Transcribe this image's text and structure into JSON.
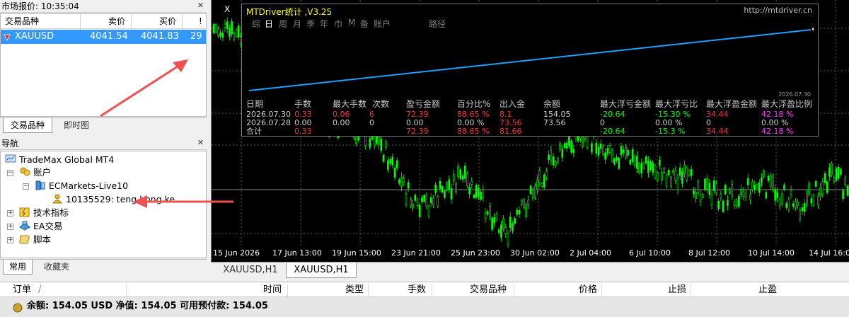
{
  "market_watch": {
    "title": "市场报价: 10:35:04",
    "columns": {
      "symbol": "交易品种",
      "bid": "卖价",
      "ask": "买价",
      "spread": "!"
    },
    "rows": [
      {
        "symbol": "XAUUSD",
        "bid": "4041.54",
        "ask": "4041.83",
        "spread": "29",
        "direction": "down"
      }
    ],
    "tabs": [
      {
        "label": "交易品种",
        "active": true
      },
      {
        "label": "即时图",
        "active": false
      }
    ]
  },
  "navigator": {
    "title": "导航",
    "root": "TradeMax Global MT4",
    "accounts_label": "账户",
    "server": "ECMarkets-Live10",
    "account": "10135529: teng hong ke",
    "indicators": "技术指标",
    "experts": "EA交易",
    "scripts": "脚本",
    "tabs": [
      {
        "label": "常用",
        "active": true
      },
      {
        "label": "收藏夹",
        "active": false
      }
    ]
  },
  "chart": {
    "symbol_label": "X",
    "background": "#000000",
    "candle_color": "#00ff00",
    "grid_color": "#5a5a5a",
    "x_ticks": [
      "15 Jun 2026",
      "17 Jun 13:00",
      "19 Jun 15:00",
      "23 Jun 21:00",
      "25 Jun 23:00",
      "30 Jun 02:00",
      "2 Jul 04:00",
      "6 Jul 10:00",
      "8 Jul 12:00",
      "10 Jul 14:00",
      "14 Jul 16:00"
    ],
    "tabs": [
      {
        "label": "XAUUSD,H1",
        "active": false
      },
      {
        "label": "XAUUSD,H1",
        "active": true
      }
    ]
  },
  "mtdriver": {
    "title": "MTDriver统计 ,V3.25",
    "url": "http://mtdriver.cn",
    "tabs": [
      "综",
      "日",
      "周",
      "月",
      "季",
      "年",
      "巾",
      "M",
      "备",
      "账户",
      "路径"
    ],
    "selected_tab": "日",
    "equity_date_label": "2026.07.30",
    "headers": [
      "日期",
      "手数",
      "最大手数",
      "次数",
      "盈亏金额",
      "百分比%",
      "出入金",
      "余额",
      "最大浮亏金额",
      "最大浮亏比",
      "最大浮盈金额",
      "最大浮盈比例"
    ],
    "rows": [
      [
        "2026.07.30",
        "0.33",
        "0.06",
        "6",
        "72.39",
        "88.65 %",
        "8.1",
        "154.05",
        "-20.64",
        "-15.30 %",
        "34.44",
        "42.18 %"
      ],
      [
        "2026.07.28",
        "0.00",
        "0.00",
        "0",
        "0.00",
        "0.00 %",
        "73.56",
        "73.56",
        "0",
        "0.00 %",
        "0",
        "0.00 %"
      ]
    ],
    "total": [
      "合计",
      "0.33",
      "",
      "",
      "72.39",
      "88.65 %",
      "81.66",
      "",
      "-20.64",
      "-15.3 %",
      "34.44",
      "42.18 %"
    ]
  },
  "terminal": {
    "columns": [
      "订单",
      "/",
      "时间",
      "类型",
      "手数",
      "交易品种",
      "价格",
      "止损",
      "止盈"
    ],
    "balance_line": "余额: 154.05 USD  净值: 154.05  可用预付款: 154.05"
  },
  "colors": {
    "accent": "#3399ff",
    "arrow": "#f05050",
    "profit_red": "#ff3333",
    "profit_green": "#00ff00"
  }
}
